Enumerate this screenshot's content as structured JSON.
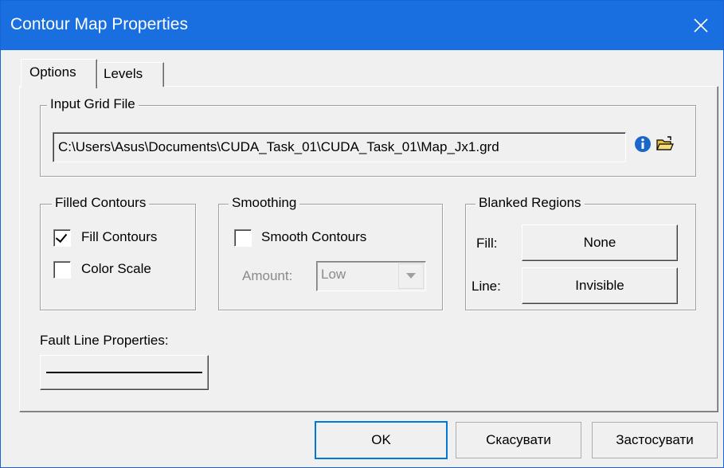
{
  "window": {
    "title": "Contour Map Properties"
  },
  "tabs": [
    {
      "label": "Options",
      "active": true
    },
    {
      "label": "Levels",
      "active": false
    }
  ],
  "input_grid": {
    "legend": "Input Grid File",
    "path": "C:\\Users\\Asus\\Documents\\CUDA_Task_01\\CUDA_Task_01\\Map_Jx1.grd",
    "info_icon": "info-icon",
    "open_icon": "open-folder-icon"
  },
  "filled_contours": {
    "legend": "Filled Contours",
    "fill_label": "Fill Contours",
    "fill_checked": true,
    "color_scale_label": "Color Scale",
    "color_scale_checked": false
  },
  "smoothing": {
    "legend": "Smoothing",
    "smooth_label": "Smooth Contours",
    "smooth_checked": false,
    "amount_label": "Amount:",
    "amount_value": "Low"
  },
  "blanked": {
    "legend": "Blanked Regions",
    "fill_label": "Fill:",
    "fill_value": "None",
    "line_label": "Line:",
    "line_value": "Invisible"
  },
  "fault_line": {
    "label": "Fault Line Properties:"
  },
  "footer": {
    "ok": "OK",
    "cancel": "Скасувати",
    "apply": "Застосувати"
  },
  "colors": {
    "titlebar": "#1a6fe0",
    "accent": "#0078d7"
  }
}
